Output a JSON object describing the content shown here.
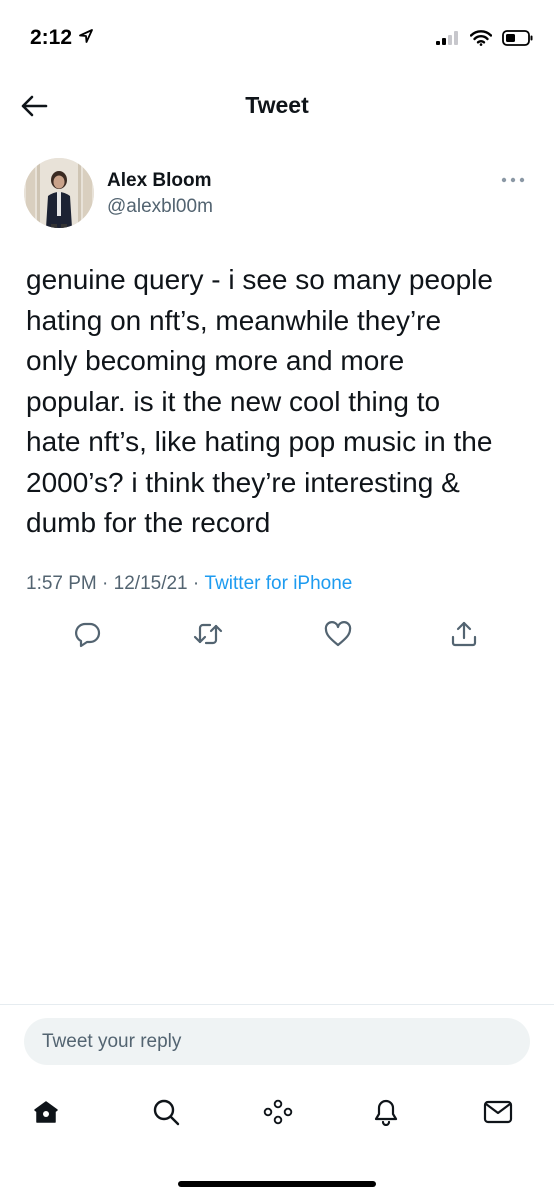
{
  "status_bar": {
    "time": "2:12",
    "icons": [
      "location-arrow-icon",
      "cellular-signal-icon",
      "wifi-icon",
      "battery-icon"
    ]
  },
  "header": {
    "title": "Tweet",
    "back_icon": "arrow-left-icon"
  },
  "tweet": {
    "author": {
      "name": "Alex Bloom",
      "handle": "@alexbl00m"
    },
    "more_icon": "more-horizontal-icon",
    "text": "genuine query - i see so many people\nhating on nft’s, meanwhile they’re\nonly becoming more and more\npopular. is it the new cool thing to\nhate nft’s, like hating pop music in the\n2000’s? i think they’re interesting &\ndumb for the record",
    "time": "1:57 PM",
    "separator": " · ",
    "date": "12/15/21",
    "source": "Twitter for iPhone",
    "actions": [
      "reply-icon",
      "retweet-icon",
      "like-icon",
      "share-icon"
    ]
  },
  "reply": {
    "placeholder": "Tweet your reply",
    "value": ""
  },
  "tab_bar": {
    "items": [
      "home-icon",
      "search-icon",
      "spaces-icon",
      "notifications-icon",
      "messages-icon"
    ]
  },
  "colors": {
    "text": "#0f1419",
    "secondary": "#536471",
    "link": "#1d9bf0",
    "reply_bg": "#eff3f4"
  }
}
